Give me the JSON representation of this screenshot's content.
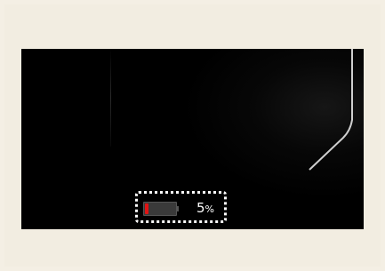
{
  "battery": {
    "percent_value": "5",
    "percent_unit": "%",
    "level_fraction": 0.05
  },
  "colors": {
    "screen": "#000000",
    "background": "#f4efe4",
    "battery_low": "#e01414",
    "highlight_border": "#ffffff"
  },
  "icons": {
    "battery": "battery-low-icon"
  }
}
